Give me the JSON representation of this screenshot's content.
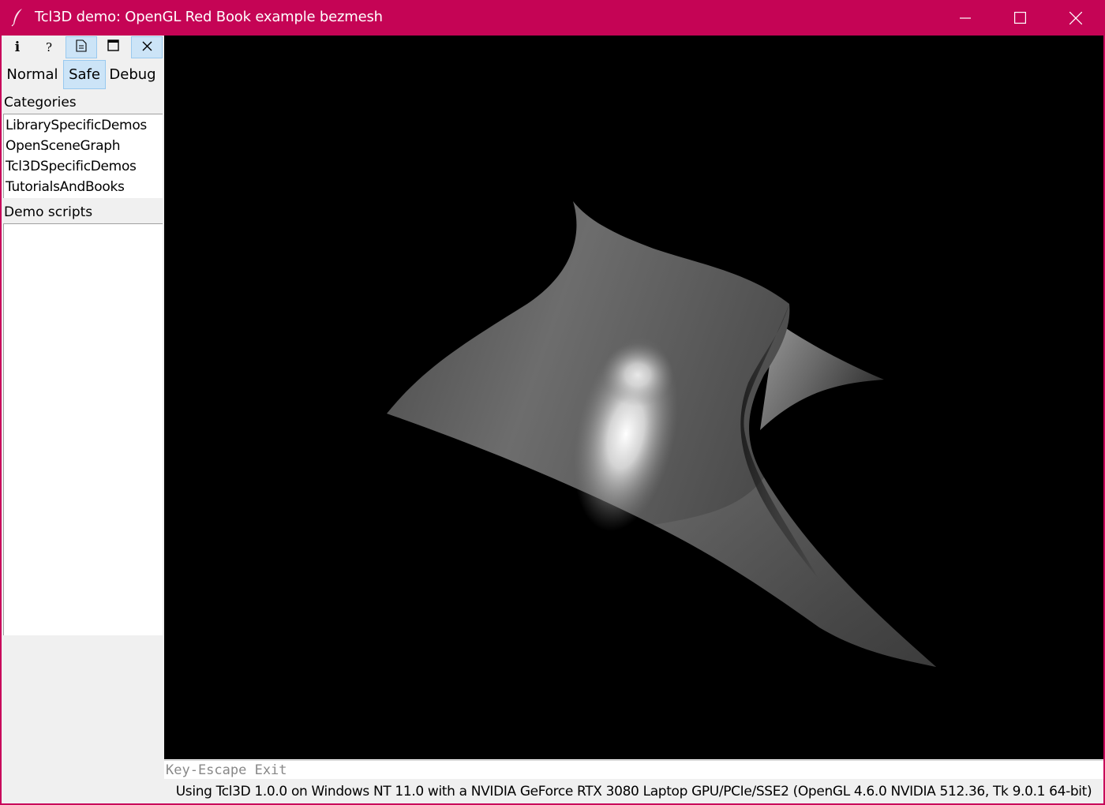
{
  "window": {
    "title": "Tcl3D demo: OpenGL Red Book example bezmesh",
    "icon": "feather-icon",
    "controls": [
      "minimize-icon",
      "maximize-icon",
      "close-icon"
    ]
  },
  "toolbar": {
    "info_label": "i",
    "help_label": "?",
    "icons": [
      "info-icon",
      "help-icon",
      "document-icon",
      "window-icon",
      "close-icon"
    ]
  },
  "modes": {
    "items": [
      "Normal",
      "Safe",
      "Debug"
    ],
    "selected": "Safe"
  },
  "categories": {
    "label": "Categories",
    "items": [
      "LibrarySpecificDemos",
      "OpenSceneGraph",
      "Tcl3DSpecificDemos",
      "TutorialsAndBooks"
    ]
  },
  "demo_scripts": {
    "label": "Demo scripts",
    "items": []
  },
  "canvas": {
    "background": "#000000"
  },
  "key_hint": "Key-Escape Exit",
  "status": "Using Tcl3D 1.0.0 on Windows NT 11.0 with a NVIDIA GeForce RTX 3080 Laptop GPU/PCIe/SSE2 (OpenGL 4.6.0 NVIDIA 512.36, Tk 9.0.1 64-bit)",
  "colors": {
    "titlebar": "#c50455",
    "selection": "#cce4f7"
  }
}
